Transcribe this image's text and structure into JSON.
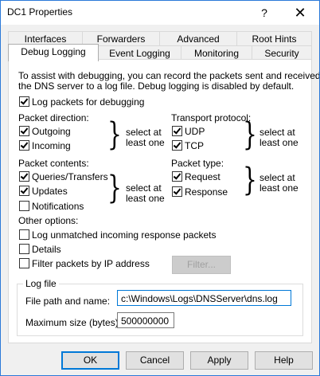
{
  "window": {
    "title": "DC1 Properties",
    "help_glyph": "?",
    "close_glyph": "✕"
  },
  "tabs_back": [
    "Interfaces",
    "Forwarders",
    "Advanced",
    "Root Hints"
  ],
  "tabs_front": [
    "Debug Logging",
    "Event Logging",
    "Monitoring",
    "Security"
  ],
  "active_tab": "Debug Logging",
  "intro": [
    "To assist with debugging, you can record the packets sent and received by",
    "the DNS server to a log file. Debug logging is disabled by default."
  ],
  "log_packets": {
    "label": "Log packets for debugging",
    "checked": true
  },
  "packet_direction": {
    "heading": "Packet direction:",
    "options": [
      {
        "label": "Outgoing",
        "checked": true
      },
      {
        "label": "Incoming",
        "checked": true
      }
    ],
    "hint": [
      "select at",
      "least one"
    ]
  },
  "transport_protocol": {
    "heading": "Transport protocol:",
    "options": [
      {
        "label": "UDP",
        "checked": true
      },
      {
        "label": "TCP",
        "checked": true
      }
    ],
    "hint": [
      "select at",
      "least one"
    ]
  },
  "packet_contents": {
    "heading": "Packet contents:",
    "options": [
      {
        "label": "Queries/Transfers",
        "checked": true
      },
      {
        "label": "Updates",
        "checked": true
      },
      {
        "label": "Notifications",
        "checked": false
      }
    ],
    "hint": [
      "select at",
      "least one"
    ]
  },
  "packet_type": {
    "heading": "Packet type:",
    "options": [
      {
        "label": "Request",
        "checked": true
      },
      {
        "label": "Response",
        "checked": true
      }
    ],
    "hint": [
      "select at",
      "least one"
    ]
  },
  "other_options": {
    "heading": "Other options:",
    "options": [
      {
        "label": "Log unmatched incoming response packets",
        "checked": false
      },
      {
        "label": "Details",
        "checked": false
      },
      {
        "label": "Filter packets by IP address",
        "checked": false
      }
    ],
    "filter_button": "Filter..."
  },
  "log_file": {
    "heading": "Log file",
    "path_label": "File path and name:",
    "path_value": "c:\\Windows\\Logs\\DNSServer\\dns.log",
    "size_label": "Maximum size (bytes):",
    "size_value": "500000000"
  },
  "buttons": {
    "ok": "OK",
    "cancel": "Cancel",
    "apply": "Apply",
    "help": "Help"
  }
}
